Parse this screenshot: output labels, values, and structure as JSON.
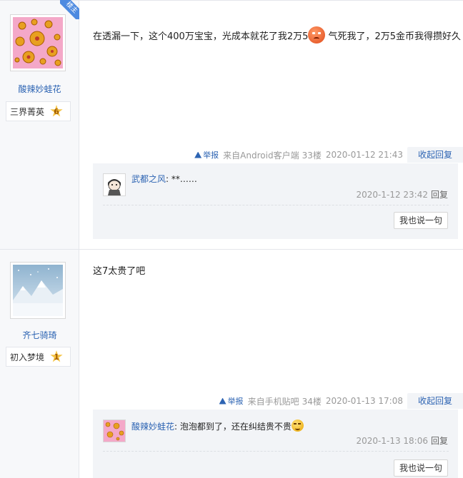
{
  "posts": [
    {
      "badge": "楼主",
      "username": "酸辣妙蛙花",
      "level_name": "三界菁英",
      "level_num": "6",
      "content_before_emoji": "在透漏一下，这个400万宝宝，光成本就花了我2万5",
      "content_after_emoji": "气死我了，2万5金币我得攒好久",
      "emoji": "angry-face-icon",
      "report_label": "举报",
      "source": "来自Android客户端",
      "floor": "33楼",
      "time": "2020-01-12 21:43",
      "collapse_label": "收起回复",
      "replies": [
        {
          "user": "武都之风",
          "text": "**……",
          "time": "2020-1-12 23:42",
          "reply_label": "回复"
        }
      ],
      "say_label": "我也说一句"
    },
    {
      "username": "齐七骑琦",
      "level_name": "初入梦境",
      "level_num": "1",
      "content": "这7太贵了吧",
      "report_label": "举报",
      "source": "来自手机贴吧",
      "floor": "34楼",
      "time": "2020-01-13 17:08",
      "collapse_label": "收起回复",
      "replies": [
        {
          "user": "酸辣妙蛙花",
          "text": "泡泡都到了，还在纠结贵不贵",
          "emoji": "sly-smile-icon",
          "time": "2020-1-13 18:06",
          "reply_label": "回复"
        }
      ],
      "say_label": "我也说一句"
    }
  ],
  "colors": {
    "link": "#2d64b3",
    "sidebar_bg": "#f7f8fa",
    "reply_bg": "#f2f4f7",
    "meta": "#999999"
  }
}
